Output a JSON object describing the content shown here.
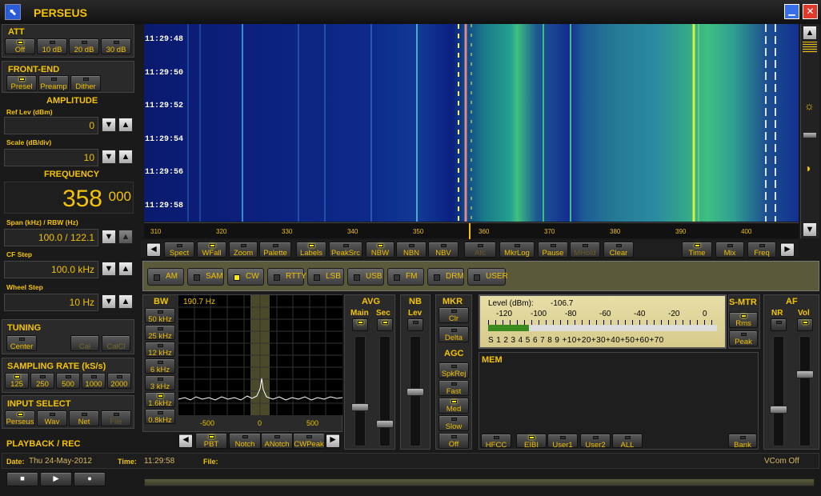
{
  "app": {
    "title": "PERSEUS"
  },
  "att": {
    "title": "ATT",
    "buttons": [
      {
        "label": "Off",
        "on": true
      },
      {
        "label": "10 dB",
        "on": false
      },
      {
        "label": "20 dB",
        "on": false
      },
      {
        "label": "30 dB",
        "on": false
      }
    ]
  },
  "frontend": {
    "title": "FRONT-END",
    "buttons": [
      {
        "label": "Presel",
        "on": true
      },
      {
        "label": "Preamp",
        "on": false
      },
      {
        "label": "Dither",
        "on": false
      }
    ]
  },
  "amplitude": {
    "title": "AMPLITUDE",
    "ref_label": "Ref Lev (dBm)",
    "ref_value": "0",
    "scale_label": "Scale (dB/div)",
    "scale_value": "10"
  },
  "frequency": {
    "title": "FREQUENCY",
    "main": "358",
    "frac": "000",
    "span_label": "Span (kHz) / RBW (Hz)",
    "span_value": "100.0 / 122.1",
    "cf_label": "CF Step",
    "cf_value": "100.0 kHz",
    "wheel_label": "Wheel Step",
    "wheel_value": "10 Hz"
  },
  "tuning": {
    "title": "TUNING",
    "center": "Center",
    "cal": "Cal",
    "calib": "CalCl"
  },
  "sampling": {
    "title": "SAMPLING RATE (kS/s)",
    "buttons": [
      {
        "label": "125",
        "on": true
      },
      {
        "label": "250",
        "on": false
      },
      {
        "label": "500",
        "on": false
      },
      {
        "label": "1000",
        "on": false
      },
      {
        "label": "2000",
        "on": false
      }
    ]
  },
  "input": {
    "title": "INPUT SELECT",
    "buttons": [
      {
        "label": "Perseus",
        "on": true
      },
      {
        "label": "Wav",
        "on": false
      },
      {
        "label": "Net",
        "on": false
      },
      {
        "label": "File",
        "on": false
      }
    ]
  },
  "playback": {
    "title": "PLAYBACK / REC",
    "date_label": "Date:",
    "date_value": "Thu 24-May-2012",
    "time_label": "Time:",
    "time_value": "11:29:58",
    "file_label": "File:",
    "vcom": "VCom Off"
  },
  "waterfall": {
    "times": [
      "11:29:48",
      "11:29:50",
      "11:29:52",
      "11:29:54",
      "11:29:56",
      "11:29:58"
    ],
    "ticks": [
      "310",
      "320",
      "330",
      "340",
      "350",
      "360",
      "370",
      "380",
      "390",
      "400"
    ]
  },
  "toolbar": [
    {
      "label": "Spect",
      "on": false
    },
    {
      "label": "WFall",
      "on": true
    },
    {
      "label": "Zoom",
      "on": false
    },
    {
      "label": "Palette",
      "on": false
    },
    {
      "label": "Labels",
      "on": true
    },
    {
      "label": "PeakSrc",
      "on": false
    },
    {
      "label": "NBW",
      "on": true
    },
    {
      "label": "NBN",
      "on": false
    },
    {
      "label": "NBV",
      "on": false
    },
    {
      "label": "Afc",
      "on": false
    },
    {
      "label": "MkrLog",
      "on": false
    },
    {
      "label": "Pause",
      "on": false
    },
    {
      "label": "MHold",
      "on": false
    },
    {
      "label": "Clear",
      "on": false
    },
    {
      "label": "Time",
      "on": true
    },
    {
      "label": "Mix",
      "on": false
    },
    {
      "label": "Freq",
      "on": false
    }
  ],
  "modes": [
    {
      "label": "AM",
      "on": false
    },
    {
      "label": "SAM",
      "on": false
    },
    {
      "label": "CW",
      "on": true
    },
    {
      "label": "RTTY",
      "on": false
    },
    {
      "label": "LSB",
      "on": false
    },
    {
      "label": "USB",
      "on": false
    },
    {
      "label": "FM",
      "on": false
    },
    {
      "label": "DRM",
      "on": false
    },
    {
      "label": "USER",
      "on": false
    }
  ],
  "bw": {
    "title": "BW",
    "buttons": [
      {
        "label": "50 kHz",
        "on": false
      },
      {
        "label": "25 kHz",
        "on": false
      },
      {
        "label": "12 kHz",
        "on": false
      },
      {
        "label": "6 kHz",
        "on": false
      },
      {
        "label": "3 kHz",
        "on": false
      },
      {
        "label": "1.6kHz",
        "on": true
      },
      {
        "label": "0.8kHz",
        "on": false
      }
    ],
    "readout": "190.7 Hz",
    "ticks": [
      "-500",
      "0",
      "500"
    ]
  },
  "filter_buttons": [
    {
      "label": "PBT",
      "on": true
    },
    {
      "label": "Notch",
      "on": false
    },
    {
      "label": "ANotch",
      "on": false
    },
    {
      "label": "CWPeak",
      "on": false
    }
  ],
  "avg": {
    "title": "AVG",
    "main": "Main",
    "sec": "Sec"
  },
  "nb": {
    "title": "NB",
    "lev": "Lev"
  },
  "mkr": {
    "title": "MKR",
    "clr": "Clr",
    "delta": "Delta"
  },
  "agc": {
    "title": "AGC",
    "buttons": [
      {
        "label": "SpkRej",
        "on": false
      },
      {
        "label": "Fast",
        "on": false
      },
      {
        "label": "Med",
        "on": true
      },
      {
        "label": "Slow",
        "on": false
      },
      {
        "label": "Off",
        "on": false
      }
    ]
  },
  "meter": {
    "level_label": "Level (dBm):",
    "level_value": "-106.7",
    "dbm_scale": [
      "-120",
      "-100",
      "-80",
      "-60",
      "-40",
      "-20",
      "0"
    ],
    "s_scale": "S 1 2 3 4 5 6 7 8 9 +10+20+30+40+50+60+70",
    "bar_fraction": 0.18
  },
  "smtr": {
    "title": "S-MTR",
    "rms": "Rms",
    "peak": "Peak"
  },
  "af": {
    "title": "AF",
    "nr": "NR",
    "vol": "Vol"
  },
  "mem": {
    "title": "MEM",
    "buttons": [
      "HFCC",
      "EIBI",
      "User1",
      "User2",
      "ALL"
    ],
    "bank": "Bank"
  },
  "colors": {
    "accent": "#f5c400",
    "waterfall_bg": "#0a1a6e",
    "signal": "#3fbf7f"
  }
}
